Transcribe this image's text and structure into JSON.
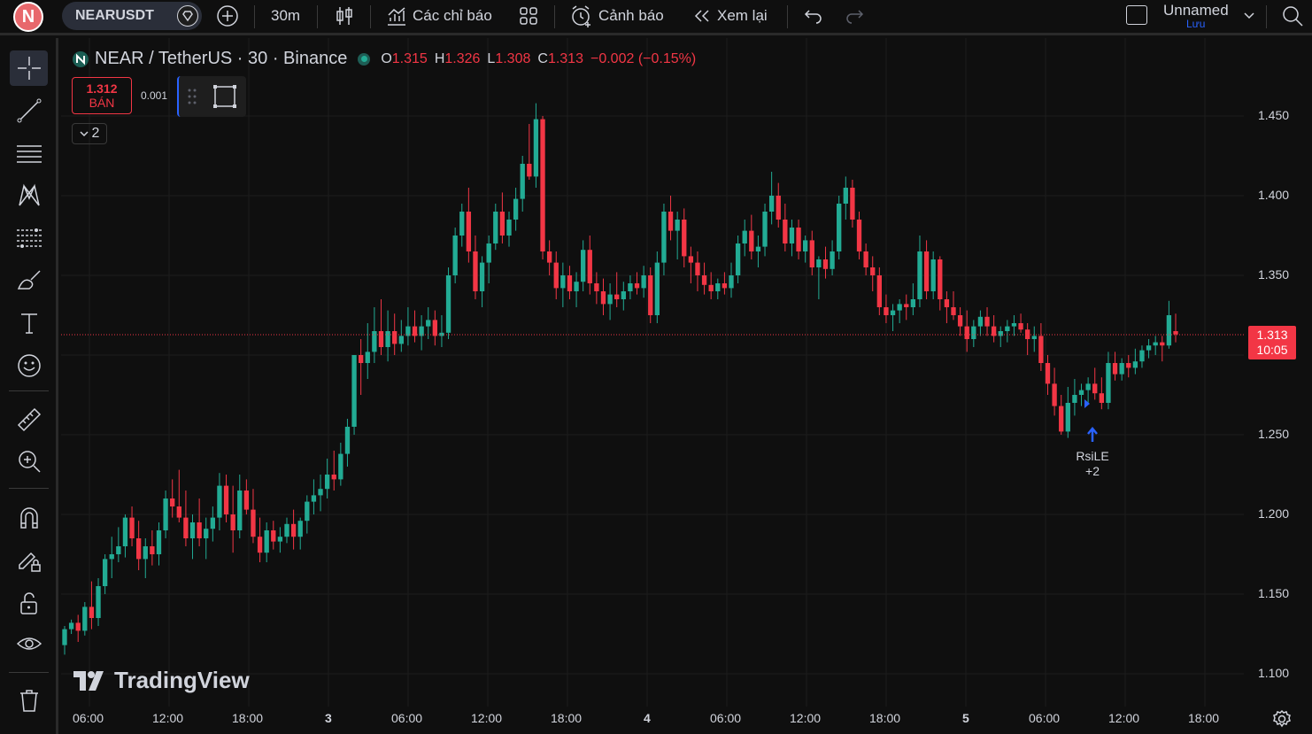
{
  "topbar": {
    "avatar_letter": "N",
    "symbol": "NEARUSDT",
    "interval": "30m",
    "indicators_label": "Các chỉ báo",
    "alerts_label": "Cảnh báo",
    "replay_label": "Xem lại",
    "layout_name": "Unnamed",
    "save_label": "Lưu"
  },
  "legend": {
    "title": "NEAR / TetherUS · 30 · Binance",
    "open_key": "O",
    "open": "1.315",
    "high_key": "H",
    "high": "1.326",
    "low_key": "L",
    "low": "1.308",
    "close_key": "C",
    "close": "1.313",
    "change": "−0.002 (−0.15%)"
  },
  "trade": {
    "sell_price": "1.312",
    "sell_label": "BÁN",
    "spread": "0.001",
    "collapse_count": "2"
  },
  "price_axis": [
    "1.450",
    "1.400",
    "1.350",
    "1.300",
    "1.250",
    "1.200",
    "1.150",
    "1.100"
  ],
  "time_axis": [
    "06:00",
    "12:00",
    "18:00",
    "3",
    "06:00",
    "12:00",
    "18:00",
    "4",
    "06:00",
    "12:00",
    "18:00",
    "5",
    "06:00",
    "12:00",
    "18:00"
  ],
  "last_price": {
    "price": "1.313",
    "countdown": "10:05"
  },
  "signal": {
    "name": "RsiLE",
    "extra": "+2"
  },
  "watermark": "TradingView",
  "colors": {
    "up": "#22ab94",
    "down": "#f23645",
    "accent": "#2962ff",
    "background": "#0f0f0f"
  },
  "chart_data": {
    "type": "candlestick",
    "interval": "30m",
    "ylim": [
      1.08,
      1.47
    ],
    "candles": [
      [
        1.118,
        1.13,
        1.112,
        1.128
      ],
      [
        1.128,
        1.134,
        1.125,
        1.132
      ],
      [
        1.132,
        1.137,
        1.12,
        1.127
      ],
      [
        1.127,
        1.145,
        1.124,
        1.142
      ],
      [
        1.142,
        1.158,
        1.128,
        1.135
      ],
      [
        1.135,
        1.16,
        1.13,
        1.155
      ],
      [
        1.155,
        1.175,
        1.15,
        1.172
      ],
      [
        1.172,
        1.186,
        1.16,
        1.175
      ],
      [
        1.175,
        1.192,
        1.17,
        1.18
      ],
      [
        1.18,
        1.2,
        1.173,
        1.198
      ],
      [
        1.198,
        1.205,
        1.18,
        1.185
      ],
      [
        1.185,
        1.196,
        1.165,
        1.172
      ],
      [
        1.172,
        1.185,
        1.16,
        1.18
      ],
      [
        1.18,
        1.19,
        1.168,
        1.175
      ],
      [
        1.175,
        1.195,
        1.168,
        1.19
      ],
      [
        1.19,
        1.215,
        1.185,
        1.21
      ],
      [
        1.21,
        1.222,
        1.198,
        1.205
      ],
      [
        1.205,
        1.228,
        1.195,
        1.198
      ],
      [
        1.198,
        1.215,
        1.18,
        1.185
      ],
      [
        1.185,
        1.2,
        1.172,
        1.195
      ],
      [
        1.195,
        1.21,
        1.18,
        1.185
      ],
      [
        1.185,
        1.198,
        1.172,
        1.191
      ],
      [
        1.191,
        1.205,
        1.183,
        1.198
      ],
      [
        1.198,
        1.226,
        1.19,
        1.218
      ],
      [
        1.218,
        1.225,
        1.195,
        1.2
      ],
      [
        1.2,
        1.218,
        1.176,
        1.19
      ],
      [
        1.19,
        1.225,
        1.185,
        1.215
      ],
      [
        1.215,
        1.222,
        1.2,
        1.203
      ],
      [
        1.203,
        1.216,
        1.182,
        1.186
      ],
      [
        1.186,
        1.198,
        1.17,
        1.176
      ],
      [
        1.176,
        1.195,
        1.17,
        1.19
      ],
      [
        1.19,
        1.196,
        1.178,
        1.183
      ],
      [
        1.183,
        1.192,
        1.176,
        1.186
      ],
      [
        1.186,
        1.198,
        1.182,
        1.194
      ],
      [
        1.194,
        1.203,
        1.178,
        1.186
      ],
      [
        1.186,
        1.198,
        1.178,
        1.196
      ],
      [
        1.196,
        1.212,
        1.188,
        1.208
      ],
      [
        1.208,
        1.222,
        1.2,
        1.212
      ],
      [
        1.212,
        1.225,
        1.202,
        1.216
      ],
      [
        1.216,
        1.235,
        1.21,
        1.225
      ],
      [
        1.225,
        1.24,
        1.215,
        1.222
      ],
      [
        1.222,
        1.245,
        1.218,
        1.238
      ],
      [
        1.238,
        1.26,
        1.23,
        1.255
      ],
      [
        1.255,
        1.29,
        1.25,
        1.3
      ],
      [
        1.3,
        1.31,
        1.275,
        1.295
      ],
      [
        1.295,
        1.32,
        1.285,
        1.302
      ],
      [
        1.302,
        1.33,
        1.295,
        1.315
      ],
      [
        1.315,
        1.335,
        1.3,
        1.305
      ],
      [
        1.305,
        1.328,
        1.296,
        1.315
      ],
      [
        1.315,
        1.326,
        1.3,
        1.307
      ],
      [
        1.307,
        1.322,
        1.302,
        1.312
      ],
      [
        1.312,
        1.33,
        1.306,
        1.318
      ],
      [
        1.318,
        1.328,
        1.308,
        1.312
      ],
      [
        1.312,
        1.325,
        1.303,
        1.318
      ],
      [
        1.318,
        1.33,
        1.31,
        1.322
      ],
      [
        1.322,
        1.328,
        1.306,
        1.312
      ],
      [
        1.312,
        1.325,
        1.305,
        1.314
      ],
      [
        1.314,
        1.355,
        1.31,
        1.35
      ],
      [
        1.35,
        1.38,
        1.345,
        1.375
      ],
      [
        1.375,
        1.395,
        1.368,
        1.39
      ],
      [
        1.39,
        1.405,
        1.358,
        1.365
      ],
      [
        1.365,
        1.375,
        1.335,
        1.34
      ],
      [
        1.34,
        1.362,
        1.33,
        1.358
      ],
      [
        1.358,
        1.375,
        1.345,
        1.37
      ],
      [
        1.37,
        1.395,
        1.366,
        1.39
      ],
      [
        1.39,
        1.402,
        1.37,
        1.375
      ],
      [
        1.375,
        1.39,
        1.368,
        1.385
      ],
      [
        1.385,
        1.405,
        1.378,
        1.398
      ],
      [
        1.398,
        1.425,
        1.39,
        1.42
      ],
      [
        1.42,
        1.445,
        1.41,
        1.412
      ],
      [
        1.412,
        1.458,
        1.405,
        1.448
      ],
      [
        1.448,
        1.45,
        1.36,
        1.365
      ],
      [
        1.365,
        1.372,
        1.35,
        1.358
      ],
      [
        1.358,
        1.365,
        1.335,
        1.342
      ],
      [
        1.342,
        1.358,
        1.33,
        1.35
      ],
      [
        1.35,
        1.356,
        1.335,
        1.34
      ],
      [
        1.34,
        1.352,
        1.33,
        1.346
      ],
      [
        1.346,
        1.372,
        1.34,
        1.366
      ],
      [
        1.366,
        1.375,
        1.338,
        1.345
      ],
      [
        1.345,
        1.352,
        1.332,
        1.34
      ],
      [
        1.34,
        1.348,
        1.325,
        1.332
      ],
      [
        1.332,
        1.345,
        1.322,
        1.338
      ],
      [
        1.338,
        1.352,
        1.33,
        1.335
      ],
      [
        1.335,
        1.346,
        1.328,
        1.34
      ],
      [
        1.34,
        1.35,
        1.335,
        1.345
      ],
      [
        1.345,
        1.352,
        1.338,
        1.342
      ],
      [
        1.342,
        1.356,
        1.336,
        1.35
      ],
      [
        1.35,
        1.355,
        1.32,
        1.325
      ],
      [
        1.325,
        1.365,
        1.32,
        1.358
      ],
      [
        1.358,
        1.395,
        1.35,
        1.39
      ],
      [
        1.39,
        1.4,
        1.372,
        1.378
      ],
      [
        1.378,
        1.39,
        1.36,
        1.385
      ],
      [
        1.385,
        1.392,
        1.355,
        1.362
      ],
      [
        1.362,
        1.368,
        1.345,
        1.358
      ],
      [
        1.358,
        1.365,
        1.34,
        1.35
      ],
      [
        1.35,
        1.358,
        1.338,
        1.344
      ],
      [
        1.344,
        1.352,
        1.335,
        1.34
      ],
      [
        1.34,
        1.348,
        1.335,
        1.345
      ],
      [
        1.345,
        1.352,
        1.338,
        1.342
      ],
      [
        1.342,
        1.358,
        1.336,
        1.35
      ],
      [
        1.35,
        1.375,
        1.345,
        1.37
      ],
      [
        1.37,
        1.385,
        1.362,
        1.378
      ],
      [
        1.378,
        1.388,
        1.36,
        1.365
      ],
      [
        1.365,
        1.375,
        1.355,
        1.368
      ],
      [
        1.368,
        1.395,
        1.362,
        1.39
      ],
      [
        1.39,
        1.415,
        1.382,
        1.4
      ],
      [
        1.4,
        1.408,
        1.38,
        1.385
      ],
      [
        1.385,
        1.395,
        1.365,
        1.37
      ],
      [
        1.37,
        1.385,
        1.362,
        1.38
      ],
      [
        1.38,
        1.385,
        1.36,
        1.365
      ],
      [
        1.365,
        1.375,
        1.358,
        1.372
      ],
      [
        1.372,
        1.378,
        1.35,
        1.355
      ],
      [
        1.355,
        1.362,
        1.335,
        1.36
      ],
      [
        1.36,
        1.368,
        1.348,
        1.354
      ],
      [
        1.354,
        1.372,
        1.35,
        1.365
      ],
      [
        1.365,
        1.4,
        1.36,
        1.395
      ],
      [
        1.395,
        1.412,
        1.385,
        1.405
      ],
      [
        1.405,
        1.41,
        1.38,
        1.385
      ],
      [
        1.385,
        1.39,
        1.36,
        1.365
      ],
      [
        1.365,
        1.37,
        1.35,
        1.355
      ],
      [
        1.355,
        1.362,
        1.34,
        1.35
      ],
      [
        1.35,
        1.355,
        1.325,
        1.33
      ],
      [
        1.33,
        1.338,
        1.32,
        1.325
      ],
      [
        1.325,
        1.332,
        1.315,
        1.328
      ],
      [
        1.328,
        1.335,
        1.32,
        1.332
      ],
      [
        1.332,
        1.338,
        1.322,
        1.33
      ],
      [
        1.33,
        1.345,
        1.325,
        1.335
      ],
      [
        1.335,
        1.375,
        1.33,
        1.365
      ],
      [
        1.365,
        1.372,
        1.335,
        1.34
      ],
      [
        1.34,
        1.365,
        1.335,
        1.36
      ],
      [
        1.36,
        1.362,
        1.328,
        1.335
      ],
      [
        1.335,
        1.34,
        1.32,
        1.33
      ],
      [
        1.33,
        1.34,
        1.322,
        1.325
      ],
      [
        1.325,
        1.33,
        1.312,
        1.318
      ],
      [
        1.318,
        1.328,
        1.302,
        1.31
      ],
      [
        1.31,
        1.322,
        1.305,
        1.318
      ],
      [
        1.318,
        1.328,
        1.312,
        1.324
      ],
      [
        1.324,
        1.33,
        1.312,
        1.318
      ],
      [
        1.318,
        1.325,
        1.308,
        1.312
      ],
      [
        1.312,
        1.318,
        1.305,
        1.315
      ],
      [
        1.315,
        1.322,
        1.308,
        1.318
      ],
      [
        1.318,
        1.325,
        1.312,
        1.32
      ],
      [
        1.32,
        1.326,
        1.314,
        1.316
      ],
      [
        1.316,
        1.32,
        1.3,
        1.31
      ],
      [
        1.31,
        1.318,
        1.302,
        1.312
      ],
      [
        1.312,
        1.32,
        1.29,
        1.295
      ],
      [
        1.295,
        1.3,
        1.275,
        1.282
      ],
      [
        1.282,
        1.292,
        1.262,
        1.268
      ],
      [
        1.268,
        1.275,
        1.25,
        1.252
      ],
      [
        1.252,
        1.28,
        1.248,
        1.27
      ],
      [
        1.27,
        1.285,
        1.262,
        1.275
      ],
      [
        1.275,
        1.282,
        1.268,
        1.278
      ],
      [
        1.278,
        1.286,
        1.27,
        1.282
      ],
      [
        1.282,
        1.292,
        1.272,
        1.276
      ],
      [
        1.276,
        1.286,
        1.266,
        1.27
      ],
      [
        1.27,
        1.302,
        1.266,
        1.295
      ],
      [
        1.295,
        1.302,
        1.284,
        1.288
      ],
      [
        1.288,
        1.298,
        1.284,
        1.295
      ],
      [
        1.295,
        1.3,
        1.286,
        1.292
      ],
      [
        1.292,
        1.304,
        1.288,
        1.296
      ],
      [
        1.296,
        1.306,
        1.292,
        1.303
      ],
      [
        1.303,
        1.31,
        1.298,
        1.306
      ],
      [
        1.306,
        1.312,
        1.3,
        1.308
      ],
      [
        1.308,
        1.312,
        1.296,
        1.306
      ],
      [
        1.306,
        1.334,
        1.304,
        1.325
      ],
      [
        1.315,
        1.326,
        1.308,
        1.313
      ]
    ]
  }
}
